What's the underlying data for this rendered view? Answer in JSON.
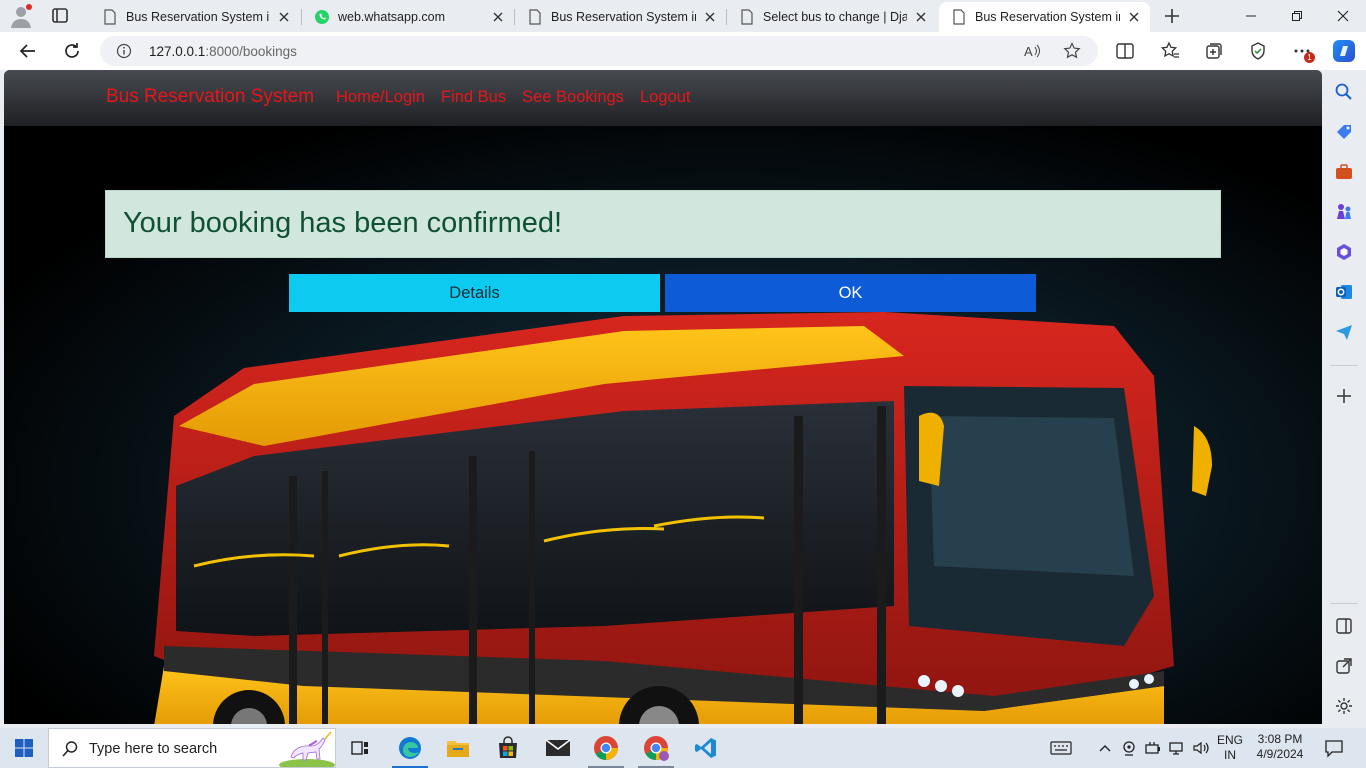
{
  "browser": {
    "tabs": [
      {
        "title": "Bus Reservation System in D",
        "icon": "page-icon",
        "active": false
      },
      {
        "title": "web.whatsapp.com",
        "icon": "whatsapp-icon",
        "active": false
      },
      {
        "title": "Bus Reservation System in D",
        "icon": "page-icon",
        "active": false
      },
      {
        "title": "Select bus to change | Djang",
        "icon": "page-icon",
        "active": false
      },
      {
        "title": "Bus Reservation System in D",
        "icon": "page-icon",
        "active": true
      }
    ],
    "url_host": "127.0.0.1",
    "url_path": ":8000/bookings",
    "extension_badge": "1"
  },
  "page": {
    "brand": "Bus Reservation System",
    "nav": [
      "Home/Login",
      "Find Bus",
      "See Bookings",
      "Logout"
    ],
    "alert": "Your booking has been confirmed!",
    "buttons": {
      "details": "Details",
      "ok": "OK"
    },
    "colors": {
      "nav_link": "#e8161a",
      "alert_bg": "#d1e7dd",
      "alert_text": "#0f5132",
      "details_btn": "#0dcaf0",
      "ok_btn": "#0d5bd7"
    }
  },
  "taskbar": {
    "search_placeholder": "Type here to search",
    "apps": [
      "task-view",
      "edge",
      "file-explorer",
      "microsoft-store",
      "mail",
      "chrome",
      "chrome-profile",
      "vscode"
    ],
    "language_line1": "ENG",
    "language_line2": "IN",
    "time": "3:08 PM",
    "date": "4/9/2024"
  }
}
